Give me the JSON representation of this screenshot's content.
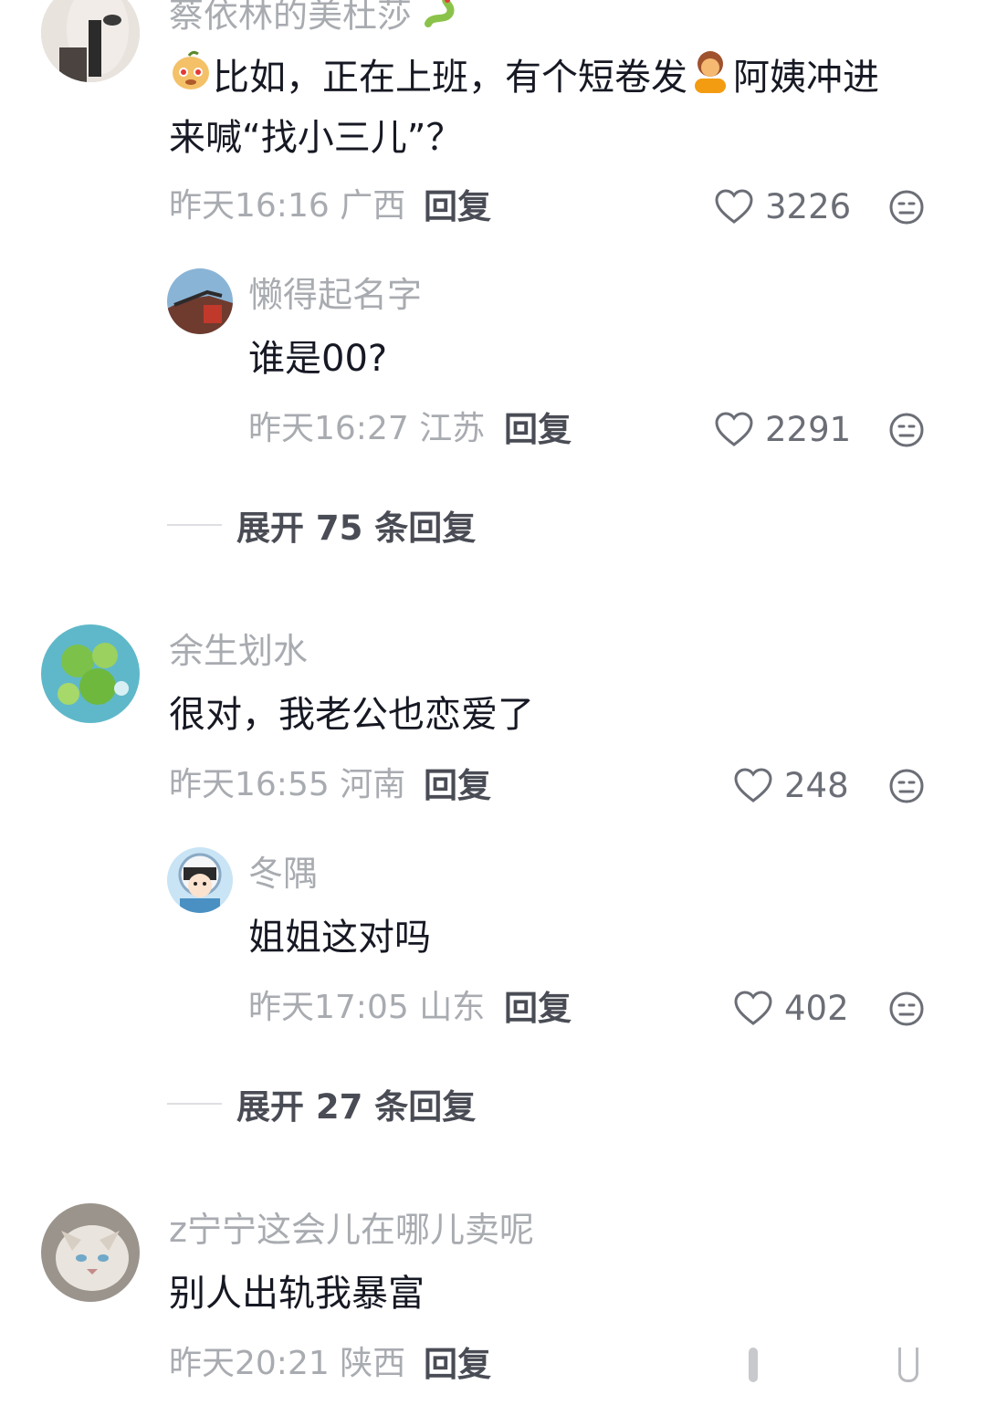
{
  "comments": [
    {
      "username": "蔡依林的美杜莎",
      "username_emoji": "snake-emoji",
      "text_line1": "比如，正在上班，有个短卷发",
      "text_emoji1": "peach-face-emoji",
      "text_emoji2": "curly-hair-person-emoji",
      "text_line1_tail": "阿姨冲进",
      "text_line2": "来喊“找小三儿”？",
      "time": "昨天16:16",
      "location": "广西",
      "reply_label": "回复",
      "likes": "3226"
    },
    {
      "username": "懒得起名字",
      "text": "谁是00?",
      "time": "昨天16:27",
      "location": "江苏",
      "reply_label": "回复",
      "likes": "2291"
    },
    {
      "expand_label": "展开 75 条回复"
    },
    {
      "username": "余生划水",
      "text": "很对，我老公也恋爱了",
      "time": "昨天16:55",
      "location": "河南",
      "reply_label": "回复",
      "likes": "248"
    },
    {
      "username": "冬隅",
      "text": "姐姐这对吗",
      "time": "昨天17:05",
      "location": "山东",
      "reply_label": "回复",
      "likes": "402"
    },
    {
      "expand_label": "展开 27 条回复"
    },
    {
      "username": "z宁宁这会儿在哪儿卖呢",
      "text": "别人出轨我暴富",
      "time": "昨天20:21",
      "location": "陕西",
      "reply_label": "回复"
    }
  ],
  "colors": {
    "name": "#a8abb0",
    "text": "#161823",
    "meta": "#a8abb0",
    "action": "#4a4c55"
  }
}
